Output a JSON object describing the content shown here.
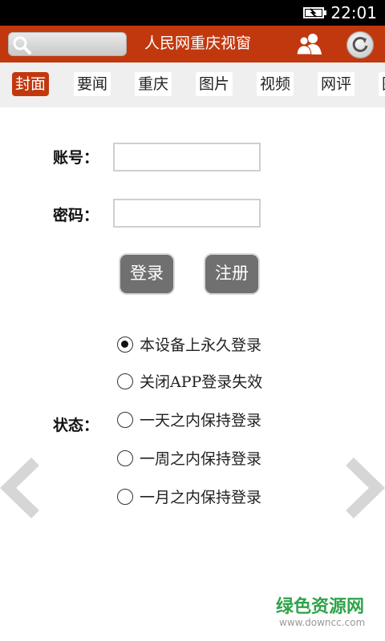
{
  "status_bar": {
    "time": "22:01",
    "battery_icon": "battery-charging-icon"
  },
  "app_bar": {
    "title": "人民网重庆视窗",
    "search_icon": "search-icon",
    "user_icon": "users-icon",
    "refresh_icon": "refresh-icon",
    "accent_color": "#c2380e"
  },
  "tabs": [
    {
      "label": "封面",
      "active": true
    },
    {
      "label": "要闻"
    },
    {
      "label": "重庆"
    },
    {
      "label": "图片"
    },
    {
      "label": "视频"
    },
    {
      "label": "网评"
    },
    {
      "label": "图"
    }
  ],
  "login": {
    "account_label": "账号：",
    "account_value": "",
    "password_label": "密码：",
    "password_value": "",
    "login_button": "登录",
    "register_button": "注册"
  },
  "status": {
    "label": "状态：",
    "options": [
      {
        "label": "本设备上永久登录",
        "selected": true
      },
      {
        "label": "关闭APP登录失效"
      },
      {
        "label": "一天之内保持登录"
      },
      {
        "label": "一周之内保持登录"
      },
      {
        "label": "一月之内保持登录"
      }
    ]
  },
  "nav": {
    "prev_icon": "chevron-left-icon",
    "next_icon": "chevron-right-icon"
  },
  "watermark": {
    "text": "绿色资源网",
    "url": "www.downcc.com"
  }
}
